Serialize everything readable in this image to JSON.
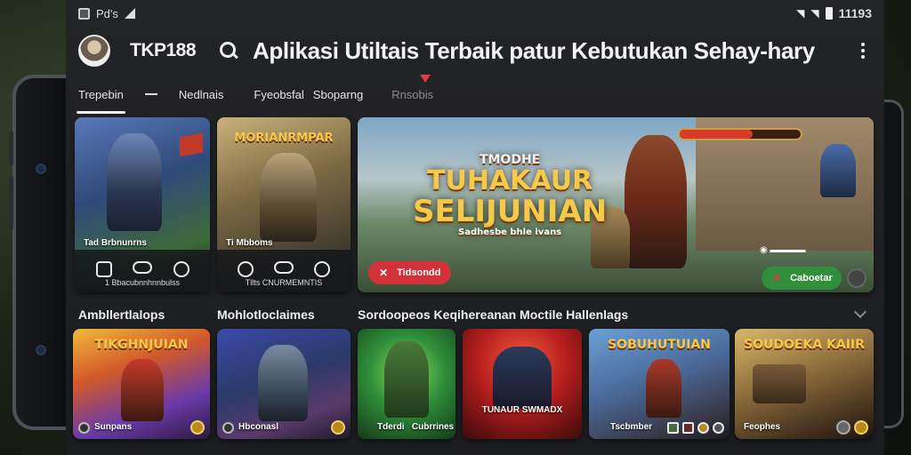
{
  "status": {
    "carrier": "Pd's",
    "time": "11193"
  },
  "app": {
    "name": "TKP188",
    "headline": "Aplikasi Utiltais Terbaik patur Kebutukan Sehay-hary"
  },
  "tabs": [
    {
      "label": "Trepebin",
      "active": true
    },
    {
      "label": "Nedlnais",
      "active": false
    },
    {
      "label": "Fyeobsfal",
      "active": false
    },
    {
      "label": "Sboparng",
      "active": false
    },
    {
      "label": "Rnsobis",
      "active": false,
      "dim": true
    }
  ],
  "featured": [
    {
      "label": "Tad Brbnunrns",
      "sub": "1 Bbacubnnhnnbulss"
    },
    {
      "label": "Ti Mbboms",
      "sub": "Tllts CNURMEMNTIS",
      "title": "MORIANRMPAR"
    }
  ],
  "hero": {
    "pre": "TMODHE",
    "line1": "TUHAKAUR",
    "line2": "SELIJUNIAN",
    "tag": "Sadhesbe bhle ivans",
    "left_button": "Tidsondd",
    "right_button": "Caboetar"
  },
  "sections": [
    "Ambllertlalops",
    "Mohlotloclaimes",
    "Sordoopeos Keqihereanan Moctile Hallenlags"
  ],
  "games": [
    {
      "title": "TIKGHNJUIAN",
      "label": "Sunpans"
    },
    {
      "title": "",
      "label": "Hbconasl"
    },
    {
      "title": "",
      "label": "Tderdi   Cubrrines"
    },
    {
      "title": "TUNAUR SWMADX",
      "label": ""
    },
    {
      "title": "SOBUHUTUIAN",
      "label": "Tscbmber"
    },
    {
      "title": "SOUDOEKA KAIIR",
      "label": "Feophes"
    }
  ],
  "colors": {
    "accent_red": "#d2313a",
    "accent_green": "#2f8f3a",
    "title_gold": "#f7c948"
  }
}
